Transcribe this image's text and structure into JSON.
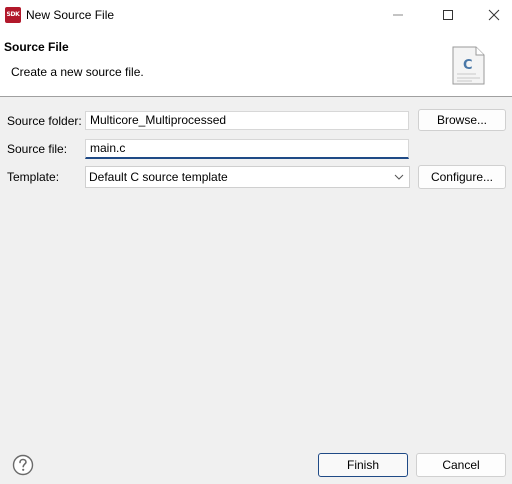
{
  "window": {
    "app_icon_text": "SDK",
    "title": "New Source File"
  },
  "banner": {
    "title": "Source File",
    "description": "Create a new source file.",
    "file_icon_letter": "C"
  },
  "form": {
    "source_folder_label": "Source folder:",
    "source_folder_value": "Multicore_Multiprocessed",
    "source_file_label": "Source file:",
    "source_file_value": "main.c",
    "template_label": "Template:",
    "template_value": "Default C source template"
  },
  "buttons": {
    "browse": "Browse...",
    "configure": "Configure...",
    "finish": "Finish",
    "cancel": "Cancel"
  },
  "icons": {
    "help": "help-icon",
    "minimize": "minimize-icon",
    "maximize": "maximize-icon",
    "close": "close-icon",
    "dropdown": "chevron-down-icon",
    "file": "c-source-file-icon"
  },
  "colors": {
    "accent": "#1f4a86",
    "app_icon": "#b2182b"
  }
}
